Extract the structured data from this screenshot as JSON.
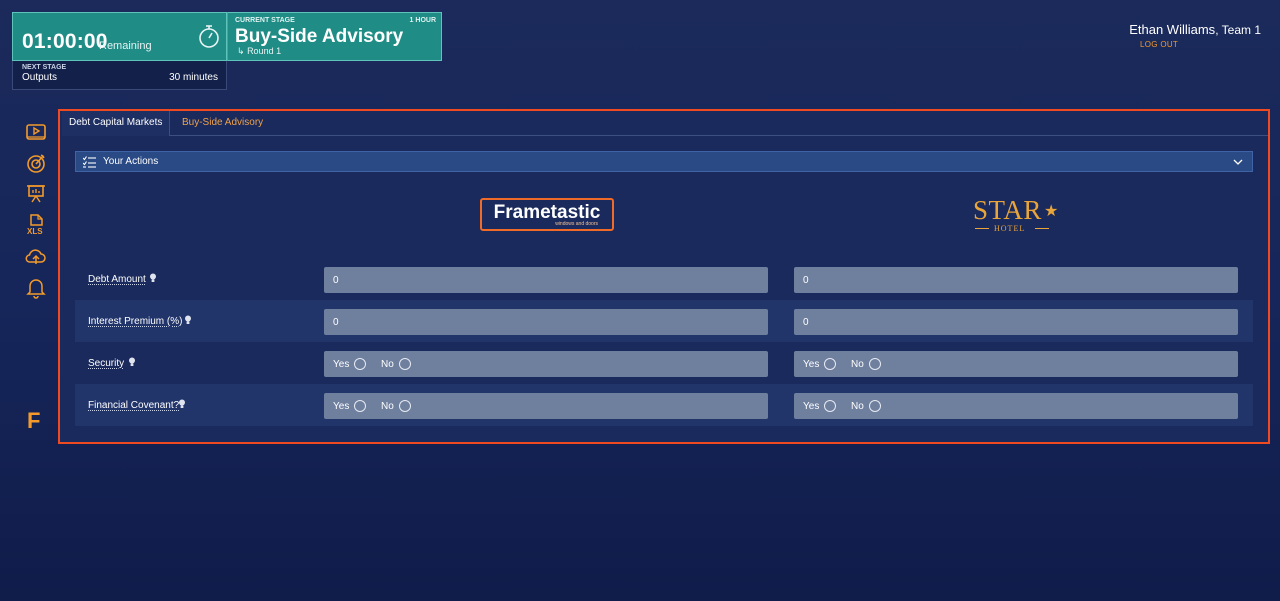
{
  "timer": {
    "value": "01:00:00",
    "remaining_label": "Remaining"
  },
  "current_stage": {
    "caption": "CURRENT STAGE",
    "duration": "1 HOUR",
    "title": "Buy-Side Advisory",
    "round": "Round 1"
  },
  "next_stage": {
    "caption": "NEXT STAGE",
    "name": "Outputs",
    "duration": "30 minutes"
  },
  "user": {
    "name": "Ethan Williams",
    "team": ", Team 1",
    "logout": "LOG OUT"
  },
  "rail": {
    "icons": [
      "video-icon",
      "target-icon",
      "presentation-icon",
      "xls-icon",
      "cloud-upload-icon",
      "bell-icon"
    ],
    "xls_text": "XLS",
    "brand": "F"
  },
  "tabs": [
    {
      "label": "Debt Capital Markets",
      "active": true
    },
    {
      "label": "Buy-Side Advisory",
      "active": false
    }
  ],
  "actions": {
    "label": "Your Actions"
  },
  "companies": [
    {
      "name": "Frametastic",
      "tagline": "windows and doors"
    },
    {
      "name": "STAR",
      "sub": "HOTEL"
    }
  ],
  "form": {
    "rows": [
      {
        "label": "Debt Amount",
        "type": "text",
        "values": [
          "0",
          "0"
        ]
      },
      {
        "label": "Interest Premium (%)",
        "type": "text",
        "values": [
          "0",
          "0"
        ]
      },
      {
        "label": "Security",
        "type": "radio",
        "options": [
          "Yes",
          "No"
        ]
      },
      {
        "label": "Financial Covenant?",
        "type": "radio",
        "options": [
          "Yes",
          "No"
        ]
      }
    ]
  },
  "colors": {
    "accent_orange": "#f04a22",
    "teal": "#1f8c86",
    "gold": "#e9a53a"
  }
}
